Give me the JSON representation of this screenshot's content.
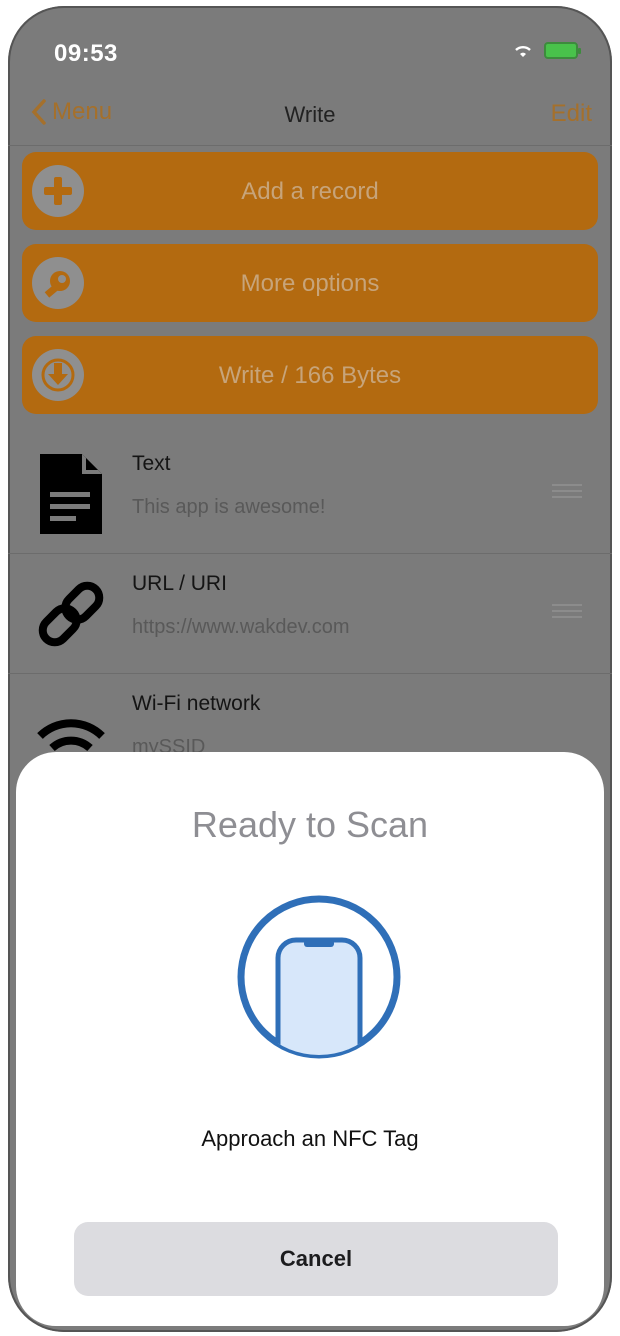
{
  "status": {
    "time": "09:53"
  },
  "nav": {
    "back_label": "Menu",
    "title": "Write",
    "edit_label": "Edit"
  },
  "actions": [
    {
      "label": "Add a record",
      "icon": "plus-circle-icon"
    },
    {
      "label": "More options",
      "icon": "wrench-circle-icon"
    },
    {
      "label": "Write / 166 Bytes",
      "icon": "download-circle-icon"
    }
  ],
  "records": [
    {
      "title": "Text",
      "subtitle": "This app is awesome!",
      "icon": "document-icon"
    },
    {
      "title": "URL / URI",
      "subtitle": "https://www.wakdev.com",
      "icon": "link-icon"
    },
    {
      "title": "Wi-Fi network",
      "subtitle": "mySSID",
      "icon": "wifi-icon"
    }
  ],
  "sheet": {
    "title": "Ready to Scan",
    "message": "Approach an NFC Tag",
    "cancel_label": "Cancel",
    "icon": "phone-scan-icon"
  },
  "colors": {
    "accent": "#b36a10",
    "scan_blue": "#2f6fb8",
    "overlay_gray": "#7b7b7b"
  }
}
